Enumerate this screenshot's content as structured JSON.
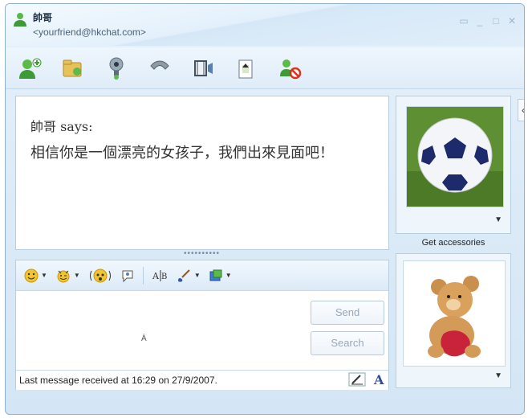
{
  "title": {
    "name": "帥哥",
    "email": "<yourfriend@hkchat.com>"
  },
  "toolbar": {
    "icons": [
      "invite-icon",
      "share-files-icon",
      "webcam-icon",
      "call-icon",
      "video-icon",
      "games-icon",
      "block-icon"
    ]
  },
  "chat": {
    "says": "帥哥 says:",
    "message": "相信你是一個漂亮的女孩子，我們出來見面吧！"
  },
  "compose": {
    "send_label": "Send",
    "search_label": "Search",
    "status": "Last message received at 16:29 on 27/9/2007."
  },
  "sidebar": {
    "accessories_label": "Get accessories"
  },
  "colors": {
    "accent": "#8fb0cf",
    "panel": "#eef5fb"
  }
}
